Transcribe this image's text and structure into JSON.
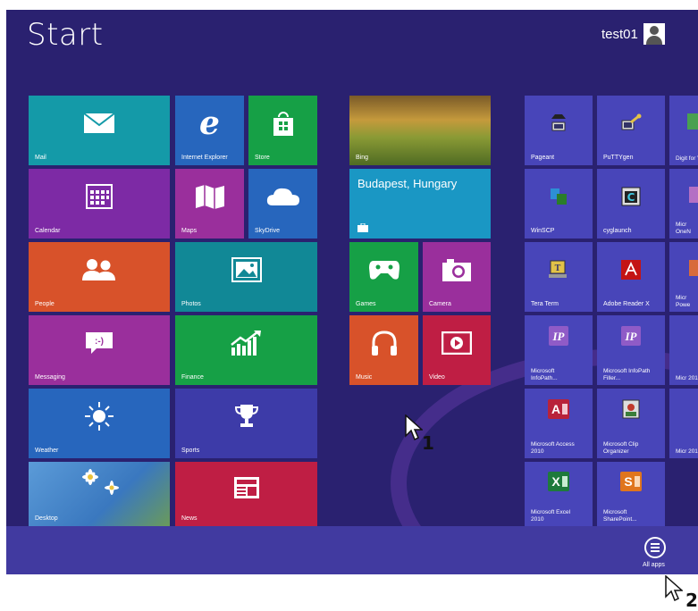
{
  "start": {
    "title": "Start",
    "username": "test01"
  },
  "tiles": {
    "mail": "Mail",
    "ie": "Internet Explorer",
    "store": "Store",
    "bing": "Bing",
    "calendar": "Calendar",
    "maps": "Maps",
    "skydrive": "SkyDrive",
    "weather_tile_city": "Budapest, Hungary",
    "people": "People",
    "photos": "Photos",
    "games": "Games",
    "camera": "Camera",
    "messaging": "Messaging",
    "finance": "Finance",
    "music": "Music",
    "video": "Video",
    "weather": "Weather",
    "sports": "Sports",
    "desktop": "Desktop",
    "news": "News"
  },
  "apps": {
    "pageant": "Pageant",
    "puttygen": "PuTTYgen",
    "digital": "Digit for V",
    "winscp": "WinSCP",
    "cyglaunch": "cyglaunch",
    "onenote": "Micr OneN",
    "teraterm": "Tera Term",
    "adobe": "Adobe Reader X",
    "powerpoint": "Micr Powe",
    "infopath": "Microsoft InfoPath...",
    "infopath_filler": "Microsoft InfoPath Filler...",
    "micr2010a": "Micr 2010",
    "access": "Microsoft Access 2010",
    "clip_organizer": "Microsoft Clip Organizer",
    "micr2010b": "Micr 2010",
    "excel": "Microsoft Excel 2010",
    "sharepoint": "Microsoft SharePoint..."
  },
  "taskbar": {
    "all_apps": "All apps"
  },
  "callouts": {
    "one": "1",
    "two": "2"
  },
  "colors": {
    "background": "#2a2170",
    "app_bar": "#413aa0"
  }
}
